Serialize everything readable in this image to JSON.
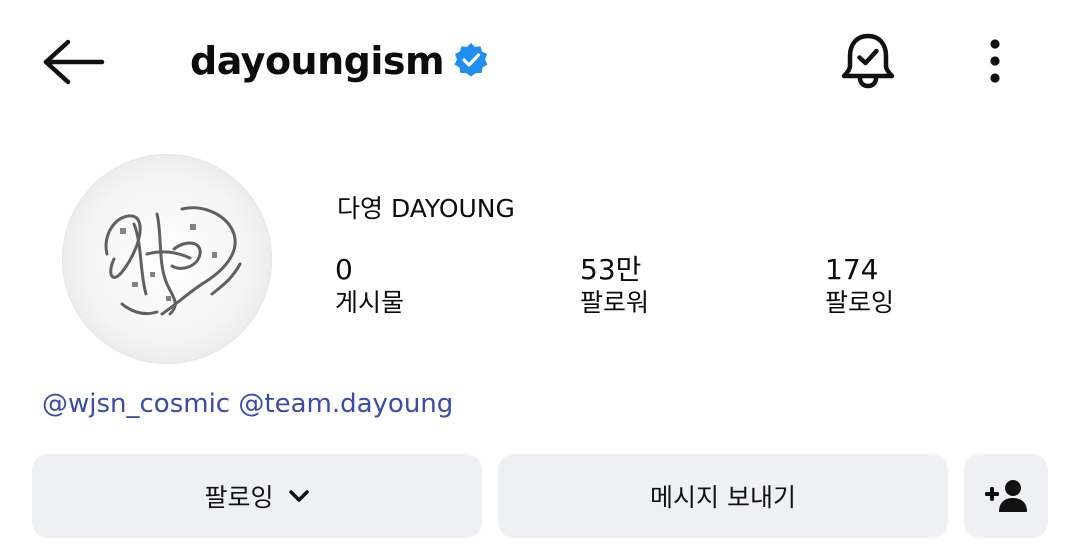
{
  "header": {
    "username": "dayoungism",
    "icons": [
      "back-arrow-icon",
      "verified-badge-icon",
      "notification-bell-icon",
      "more-options-icon"
    ],
    "verified_color": "#1f8ef1"
  },
  "profile": {
    "display_name": "다영 DAYOUNG",
    "avatar": "signature-avatar",
    "stats": [
      {
        "value": "0",
        "label": "게시물"
      },
      {
        "value": "53만",
        "label": "팔로워"
      },
      {
        "value": "174",
        "label": "팔로잉"
      }
    ]
  },
  "links": {
    "glyph": "@",
    "items": [
      "wjsn_cosmic",
      "team.dayoung"
    ],
    "color": "#3a4ba8"
  },
  "actions": {
    "follow_label": "팔로잉",
    "message_label": "메시지 보내기",
    "add_icon": "add-user-icon",
    "button_bg": "#eff0f4"
  }
}
